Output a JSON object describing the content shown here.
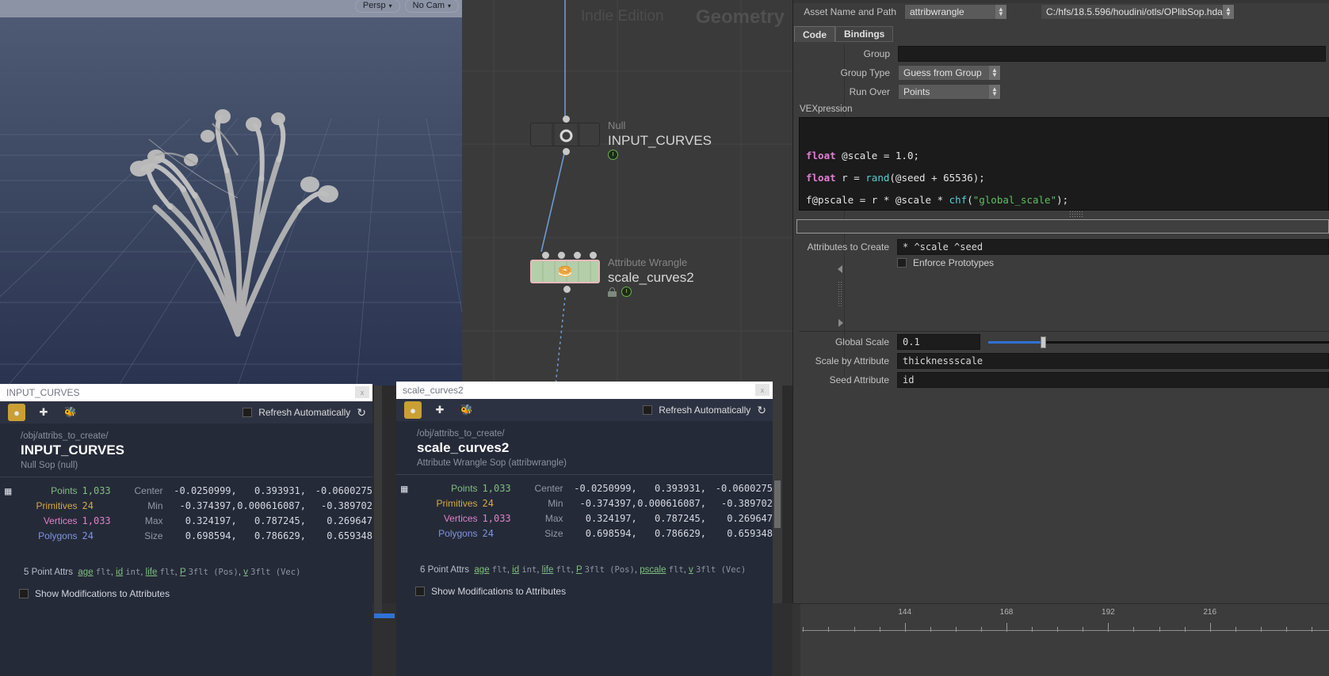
{
  "viewport": {
    "buttons": [
      {
        "label": "Persp",
        "caret": "▾"
      },
      {
        "label": "No Cam",
        "caret": "▾"
      }
    ]
  },
  "network": {
    "watermark_edition": "Indie Edition",
    "watermark_context": "Geometry",
    "nodes": [
      {
        "type": "Null",
        "name": "INPUT_CURVES",
        "flags": [
          "display-clock"
        ]
      },
      {
        "type": "Attribute Wrangle",
        "name": "scale_curves2",
        "flags": [
          "lock",
          "display-clock"
        ]
      }
    ]
  },
  "params": {
    "asset_label": "Asset Name and Path",
    "asset_name": "attribwrangle",
    "asset_path": "C:/hfs/18.5.596/houdini/otls/OPlibSop.hda",
    "tabs": [
      {
        "label": "Code",
        "selected": true
      },
      {
        "label": "Bindings",
        "selected": false
      }
    ],
    "group_label": "Group",
    "group_value": "",
    "group_type_label": "Group Type",
    "group_type_value": "Guess from Group",
    "run_over_label": "Run Over",
    "run_over_value": "Points",
    "vexpression_label": "VEXpression",
    "code_lines": [
      [
        {
          "t": "float",
          "c": "type"
        },
        {
          "t": " @scale = 1.0;",
          "c": "plain"
        }
      ],
      [
        {
          "t": "float",
          "c": "type"
        },
        {
          "t": " r = ",
          "c": "plain"
        },
        {
          "t": "rand",
          "c": "fn"
        },
        {
          "t": "(@seed + 65536);",
          "c": "plain"
        }
      ],
      [
        {
          "t": "f@pscale = r * @scale * ",
          "c": "plain"
        },
        {
          "t": "chf",
          "c": "fn"
        },
        {
          "t": "(",
          "c": "plain"
        },
        {
          "t": "\"global_scale\"",
          "c": "str"
        },
        {
          "t": ");",
          "c": "plain"
        }
      ]
    ],
    "attributes_to_create_label": "Attributes to Create",
    "attributes_to_create_value": "*  ^scale  ^seed",
    "enforce_prototypes_label": "Enforce Prototypes",
    "enforce_prototypes_checked": false,
    "global_scale_label": "Global Scale",
    "global_scale_value": "0.1",
    "global_scale_fill_pct": 16,
    "scale_by_attribute_label": "Scale by Attribute",
    "scale_by_attribute_value": "thicknessscale",
    "seed_attribute_label": "Seed Attribute",
    "seed_attribute_value": "id"
  },
  "geo_left": {
    "title": "INPUT_CURVES",
    "minimize_label": "x",
    "refresh_label": "Refresh Automatically",
    "refresh_checked": false,
    "path": "/obj/attribs_to_create/",
    "name": "INPUT_CURVES",
    "subtitle": "Null Sop (null)",
    "stats_left": [
      {
        "label": "Points",
        "value": "1,033",
        "color": "points"
      },
      {
        "label": "Primitives",
        "value": "24",
        "color": "prims"
      },
      {
        "label": "Vertices",
        "value": "1,033",
        "color": "verts"
      },
      {
        "label": "Polygons",
        "value": "24",
        "color": "polys"
      }
    ],
    "stats_right": [
      {
        "label": "Center",
        "values": [
          "-0.0250999",
          "0.393931",
          "-0.0600275"
        ]
      },
      {
        "label": "Min",
        "values": [
          "-0.374397",
          "0.000616087",
          "-0.389702"
        ]
      },
      {
        "label": "Max",
        "values": [
          "0.324197",
          "0.787245",
          "0.269647"
        ]
      },
      {
        "label": "Size",
        "values": [
          "0.698594",
          "0.786629",
          "0.659348"
        ]
      }
    ],
    "attrs_count": "5 Point Attrs",
    "attrs": [
      {
        "name": "age",
        "type": "flt"
      },
      {
        "name": "id",
        "type": "int"
      },
      {
        "name": "life",
        "type": "flt"
      },
      {
        "name": "P",
        "type": "3flt (Pos)"
      },
      {
        "name": "v",
        "type": "3flt (Vec)"
      }
    ],
    "show_mods_label": "Show Modifications to Attributes",
    "show_mods_checked": false
  },
  "geo_right": {
    "title": "scale_curves2",
    "minimize_label": "x",
    "refresh_label": "Refresh Automatically",
    "refresh_checked": false,
    "path": "/obj/attribs_to_create/",
    "name": "scale_curves2",
    "subtitle": "Attribute Wrangle Sop (attribwrangle)",
    "stats_left": [
      {
        "label": "Points",
        "value": "1,033",
        "color": "points"
      },
      {
        "label": "Primitives",
        "value": "24",
        "color": "prims"
      },
      {
        "label": "Vertices",
        "value": "1,033",
        "color": "verts"
      },
      {
        "label": "Polygons",
        "value": "24",
        "color": "polys"
      }
    ],
    "stats_right": [
      {
        "label": "Center",
        "values": [
          "-0.0250999",
          "0.393931",
          "-0.0600275"
        ]
      },
      {
        "label": "Min",
        "values": [
          "-0.374397",
          "0.000616087",
          "-0.389702"
        ]
      },
      {
        "label": "Max",
        "values": [
          "0.324197",
          "0.787245",
          "0.269647"
        ]
      },
      {
        "label": "Size",
        "values": [
          "0.698594",
          "0.786629",
          "0.659348"
        ]
      }
    ],
    "attrs_count": "6 Point Attrs",
    "attrs": [
      {
        "name": "age",
        "type": "flt"
      },
      {
        "name": "id",
        "type": "int"
      },
      {
        "name": "life",
        "type": "flt"
      },
      {
        "name": "P",
        "type": "3flt (Pos)"
      },
      {
        "name": "pscale",
        "type": "flt"
      },
      {
        "name": "v",
        "type": "3flt (Vec)"
      }
    ],
    "show_mods_label": "Show Modifications to Attributes",
    "show_mods_checked": false
  },
  "timeline": {
    "ticks": [
      {
        "frame": "144",
        "pct": 19.5,
        "major": true
      },
      {
        "frame": "168",
        "pct": 38.8,
        "major": true
      },
      {
        "frame": "192",
        "pct": 58.1,
        "major": true
      },
      {
        "frame": "216",
        "pct": 77.4,
        "major": true
      }
    ]
  },
  "colors": {
    "accent_blue": "#2f72d6",
    "gold": "#caa034",
    "node_green": "#b5ceaa",
    "node_outline_pink": "#e8b9bd"
  }
}
